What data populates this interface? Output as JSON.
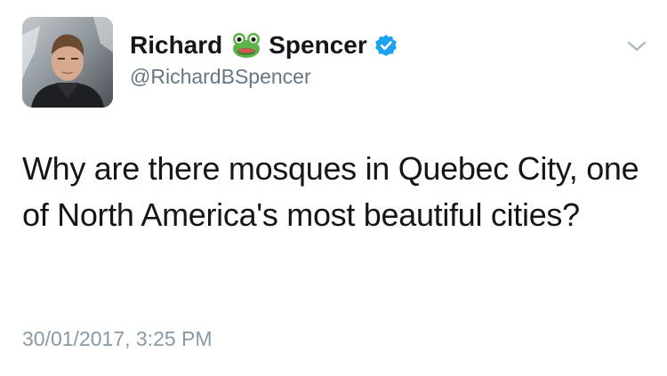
{
  "tweet": {
    "display_name_first": "Richard",
    "display_name_last": "Spencer",
    "name_emoji": "frog-icon",
    "verified": true,
    "handle": "@RichardBSpencer",
    "text": "Why are there mosques in Quebec City, one of North America's most beautiful cities?",
    "timestamp": "30/01/2017, 3:25 PM"
  },
  "colors": {
    "text": "#14171a",
    "secondary_text": "#657786",
    "timestamp_text": "#8899a6",
    "verified_badge": "#1da1f2",
    "frog": "#5db34a",
    "chevron": "#aab8c2"
  }
}
